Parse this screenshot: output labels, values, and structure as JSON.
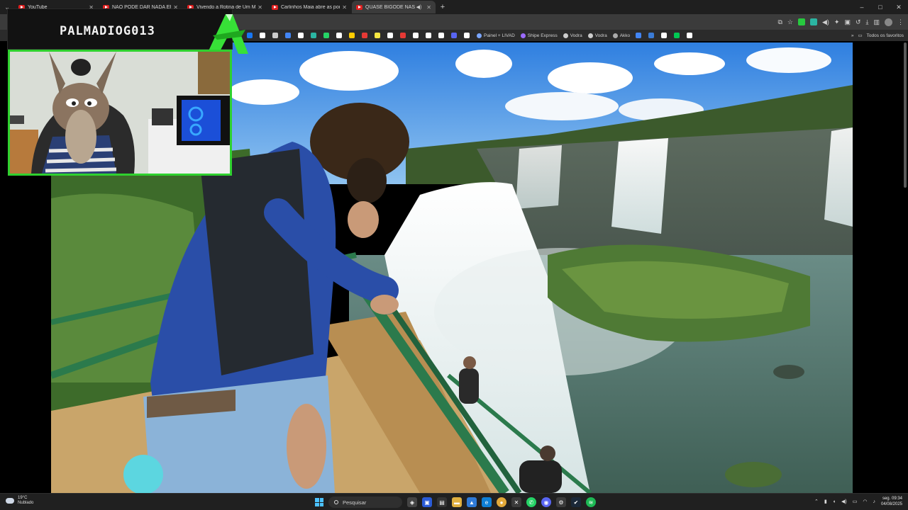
{
  "browser": {
    "tabs": [
      {
        "title": "YouTube",
        "active": false
      },
      {
        "title": "NÃO PODE DAR NADA ERRADO",
        "active": false
      },
      {
        "title": "Vivendo a Rotina de Um Milionário",
        "active": false
      },
      {
        "title": "Carlinhos Maia abre as portas",
        "active": false
      },
      {
        "title": "QUASE BIGODE NAS CATARATAS",
        "active": true
      }
    ],
    "new_tab_label": "+",
    "window_controls": [
      "–",
      "□",
      "✕"
    ],
    "bookmarks": [
      {
        "label": "Painel + LIVAD",
        "color": "#7aa6ff"
      },
      {
        "label": "Shipe Express",
        "color": "#9b6bff"
      },
      {
        "label": "Vodra",
        "color": "#cccccc"
      },
      {
        "label": "Vodra",
        "color": "#cccccc"
      },
      {
        "label": "Akko",
        "color": "#aaaaaa"
      }
    ],
    "bookmark_icon_colors": [
      "#27c93f",
      "#1877f2",
      "#ffffff",
      "#cccccc",
      "#4285f4",
      "#ffffff",
      "#2bb5a2",
      "#25d366",
      "#ffffff",
      "#ffcc00",
      "#e53935",
      "#f5e642",
      "#ffffff",
      "#e53935",
      "#ffffff",
      "#ffffff",
      "#ffffff",
      "#5865f2",
      "#ffffff",
      "#4285f4",
      "#3a7bd5",
      "#ffffff",
      "#00c853",
      "#ffffff"
    ],
    "all_bookmarks_label": "Todos os favoritos"
  },
  "overlay": {
    "channel_name": "PALMADIOG013",
    "accent_color": "#2fd12f"
  },
  "taskbar": {
    "weather_temp": "19°C",
    "weather_desc": "Nublado",
    "search_placeholder": "Pesquisar",
    "time": "09:34",
    "date": "04/08/2025",
    "day": "seg."
  },
  "colors": {
    "tabstrip": "#1f1f1f",
    "toolbar": "#3b3b3b",
    "youtube_red": "#e02020"
  }
}
